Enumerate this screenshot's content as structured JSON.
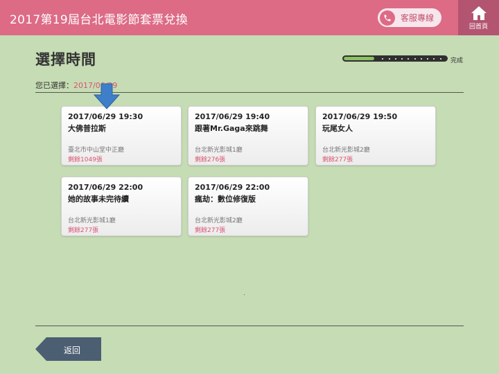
{
  "header": {
    "title": "2017第19屆台北電影節套票兌換",
    "service_label": "客服專線",
    "home_label": "回首頁"
  },
  "page": {
    "title": "選擇時間",
    "progress_label": "完成",
    "progress_fraction": 0.3,
    "selected_prefix": "您已選擇：",
    "selected_value": "2017/06/29"
  },
  "showtimes": [
    {
      "time": "2017/06/29 19:30",
      "movie": "大佛普拉斯",
      "venue": "臺北市中山堂中正廳",
      "remaining": "剩餘1049張"
    },
    {
      "time": "2017/06/29 19:40",
      "movie": "跟著Mr.Gaga來跳舞",
      "venue": "台北新光影城1廳",
      "remaining": "剩餘276張"
    },
    {
      "time": "2017/06/29 19:50",
      "movie": "玩尾女人",
      "venue": "台北新光影城2廳",
      "remaining": "剩餘277張"
    },
    {
      "time": "2017/06/29 22:00",
      "movie": "她的故事未完待續",
      "venue": "台北新光影城1廳",
      "remaining": "剩餘277張"
    },
    {
      "time": "2017/06/29 22:00",
      "movie": "瘋劫：數位修復版",
      "venue": "台北新光影城2廳",
      "remaining": "剩餘277張"
    }
  ],
  "footer": {
    "back_label": "返回"
  },
  "colors": {
    "header": "#dd6b86",
    "home": "#b35470",
    "background": "#c6dcb4",
    "accent_text": "#d9536f",
    "progress_fill": "#8cc063",
    "arrow": "#3f7fc9",
    "back_button": "#4c5e72"
  }
}
